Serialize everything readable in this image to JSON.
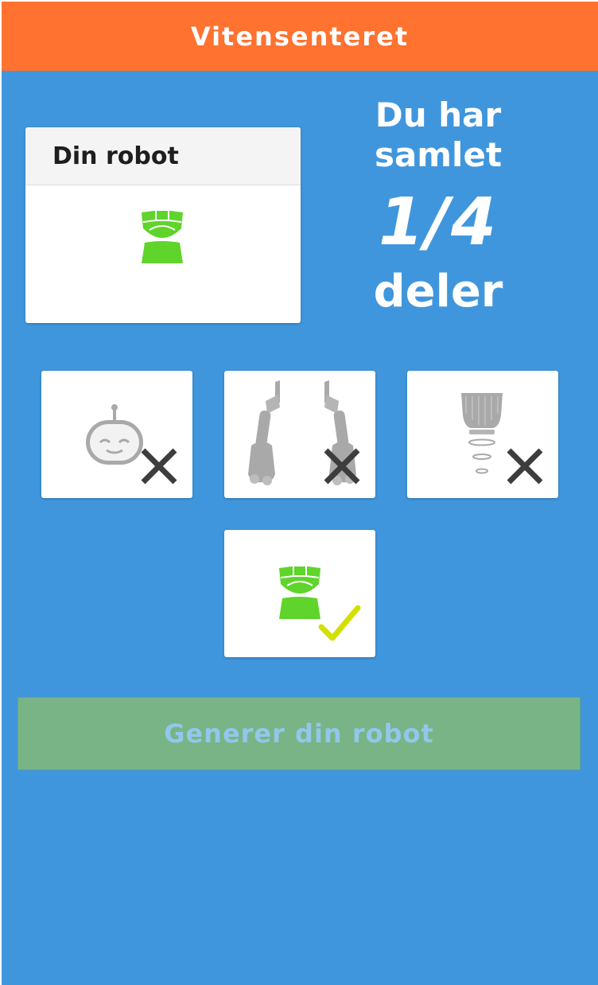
{
  "header": {
    "title": "Vitensenteret"
  },
  "robot_card": {
    "title": "Din robot",
    "current_part_icon": "robot-torso-icon"
  },
  "progress": {
    "line1": "Du har",
    "line2": "samlet",
    "count": "1/4",
    "suffix": "deler"
  },
  "parts": [
    {
      "name": "head",
      "icon": "robot-head-icon",
      "collected": false,
      "status_icon": "cross-icon"
    },
    {
      "name": "arms",
      "icon": "robot-arms-icon",
      "collected": false,
      "status_icon": "cross-icon"
    },
    {
      "name": "legs",
      "icon": "robot-legs-icon",
      "collected": false,
      "status_icon": "cross-icon"
    },
    {
      "name": "torso",
      "icon": "robot-torso-icon",
      "collected": true,
      "status_icon": "checkmark-icon"
    }
  ],
  "generate_button": {
    "label": "Generer din robot",
    "enabled": false
  },
  "colors": {
    "header": "#ff7230",
    "background": "#4096dc",
    "collected_part": "#5fd42b",
    "missing_part": "#a9a9a9",
    "cross": "#3d3d3d",
    "check": "#d4e000",
    "button_disabled": "#78b485"
  }
}
